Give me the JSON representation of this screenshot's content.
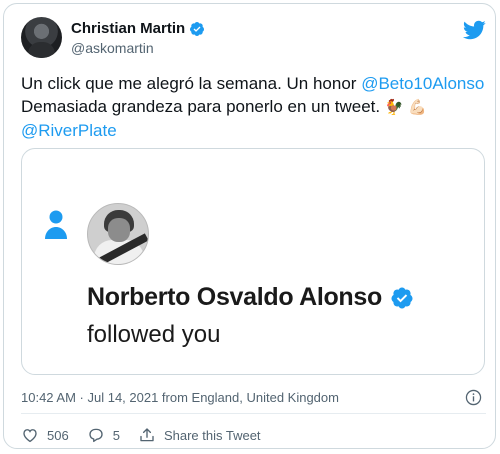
{
  "author": {
    "name": "Christian Martin",
    "handle": "@askomartin"
  },
  "tweet": {
    "part1": "Un click que me alegró la semana. Un honor ",
    "mention1": "@Beto10Alonso",
    "part2": " Demasiada grandeza para ponerlo en un tweet. ",
    "emoji1": "🐓",
    "emoji2": "💪🏻",
    "mention2": "@RiverPlate"
  },
  "media": {
    "follower_name": "Norberto Osvaldo Alonso",
    "followed_text": "followed you"
  },
  "meta": {
    "timestamp": "10:42 AM · Jul 14, 2021 from England, United Kingdom"
  },
  "actions": {
    "likes": "506",
    "replies": "5",
    "share_label": "Share this Tweet"
  },
  "colors": {
    "accent": "#1d9bf0",
    "text_secondary": "#536471"
  }
}
